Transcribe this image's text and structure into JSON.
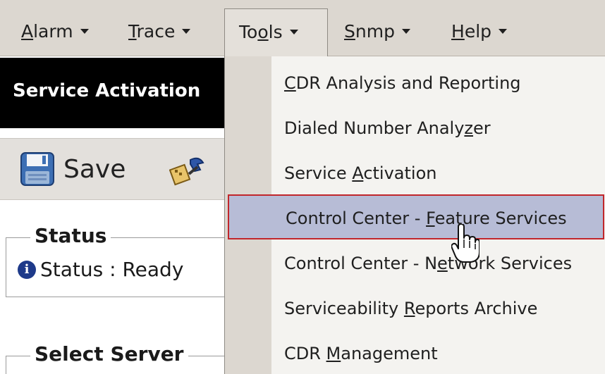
{
  "menubar": {
    "items": [
      {
        "label": "Alarm",
        "mnemonic": "A",
        "rest": "larm"
      },
      {
        "label": "Trace",
        "mnemonic": "T",
        "rest": "race"
      },
      {
        "label": "Tools",
        "pre": "To",
        "mnemonic": "o",
        "rest": "ls"
      },
      {
        "label": "Snmp",
        "mnemonic": "S",
        "rest": "nmp"
      },
      {
        "label": "Help",
        "mnemonic": "H",
        "rest": "elp"
      }
    ]
  },
  "page": {
    "title": "Service Activation"
  },
  "toolbar": {
    "save_label": "Save"
  },
  "status": {
    "legend": "Status",
    "text": "Status : Ready"
  },
  "select_server": {
    "legend": "Select Server"
  },
  "tools_menu": {
    "items": [
      {
        "pre": "",
        "mnemonic": "C",
        "post": "DR Analysis and Reporting"
      },
      {
        "pre": "Dialed Number Analy",
        "mnemonic": "z",
        "post": "er"
      },
      {
        "pre": "Service ",
        "mnemonic": "A",
        "post": "ctivation"
      },
      {
        "pre": "Control Center - ",
        "mnemonic": "F",
        "post": "eature Services"
      },
      {
        "pre": "Control Center - N",
        "mnemonic": "e",
        "post": "twork Services"
      },
      {
        "pre": "Serviceability ",
        "mnemonic": "R",
        "post": "eports Archive"
      },
      {
        "pre": "CDR ",
        "mnemonic": "M",
        "post": "anagement"
      }
    ],
    "highlighted_index": 3
  },
  "colors": {
    "menubar": "#dcd7d0",
    "header_bg": "#000000",
    "highlight_bg": "#b7bcd6",
    "highlight_border": "#c1262b"
  },
  "icons": {
    "save": "floppy-disk-icon",
    "tool": "tool-icon",
    "info": "info-icon",
    "cursor": "hand-pointer-icon"
  }
}
